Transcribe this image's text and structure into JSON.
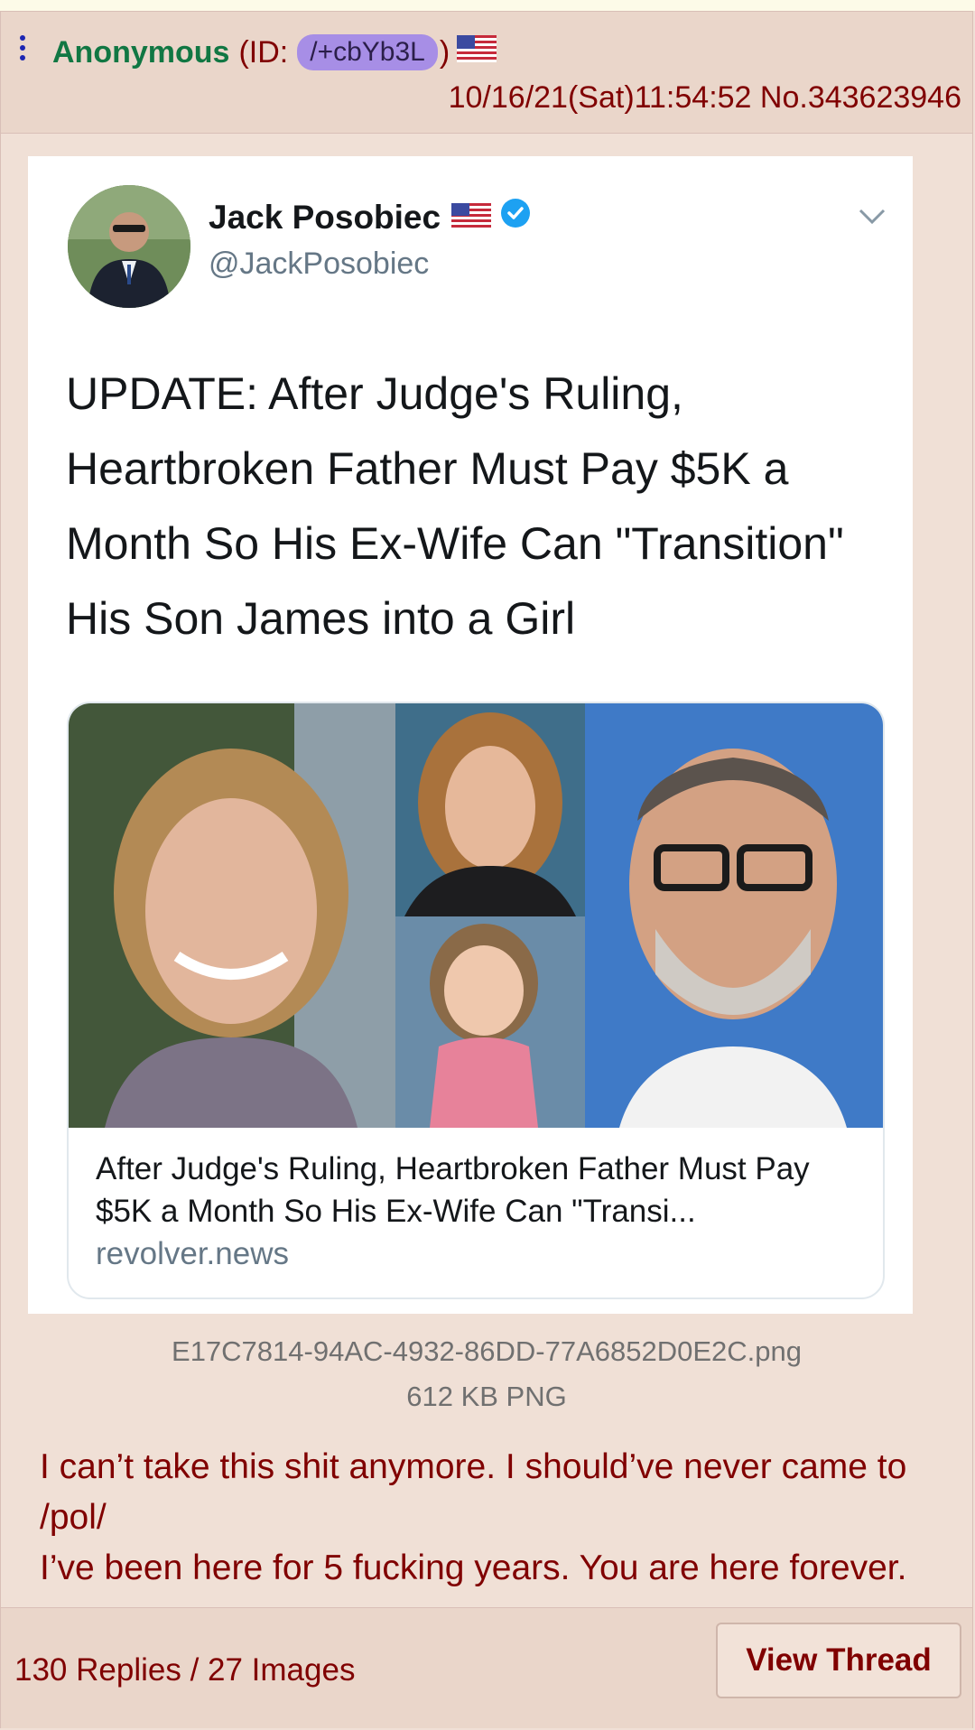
{
  "post": {
    "poster_name": "Anonymous",
    "id_prefix": "(ID:",
    "id_value": "/+cbYb3L",
    "id_suffix": ")",
    "flag": "us-flag-icon",
    "datetime": "10/16/21(Sat)11:54:52 No.343623946"
  },
  "attachment": {
    "tweet": {
      "display_name": "Jack Posobiec",
      "handle": "@JackPosobiec",
      "text": "UPDATE: After Judge's Ruling, Heartbroken Father Must Pay $5K a Month So His Ex-Wife Can \"Transition\" His Son James into a Girl",
      "link_title": "After Judge's Ruling, Heartbroken Father Must Pay $5K a Month So His Ex-Wife Can \"Transi...",
      "link_domain": "revolver.news"
    },
    "filename": "E17C7814-94AC-4932-86DD-77A6852D0E2C.png",
    "filesize": "612 KB PNG"
  },
  "comment": {
    "line1": "I can’t take this shit anymore. I should’ve never came to /pol/",
    "line2": "I’ve been here for 5 fucking years. You are here forever."
  },
  "footer": {
    "reply_summary": "130 Replies / 27 Images",
    "view_thread_label": "View Thread"
  },
  "colors": {
    "background": "#f0e0d6",
    "header": "#ead6ca",
    "name": "#117743",
    "text": "#800000",
    "id_badge": "#a78ee6"
  }
}
